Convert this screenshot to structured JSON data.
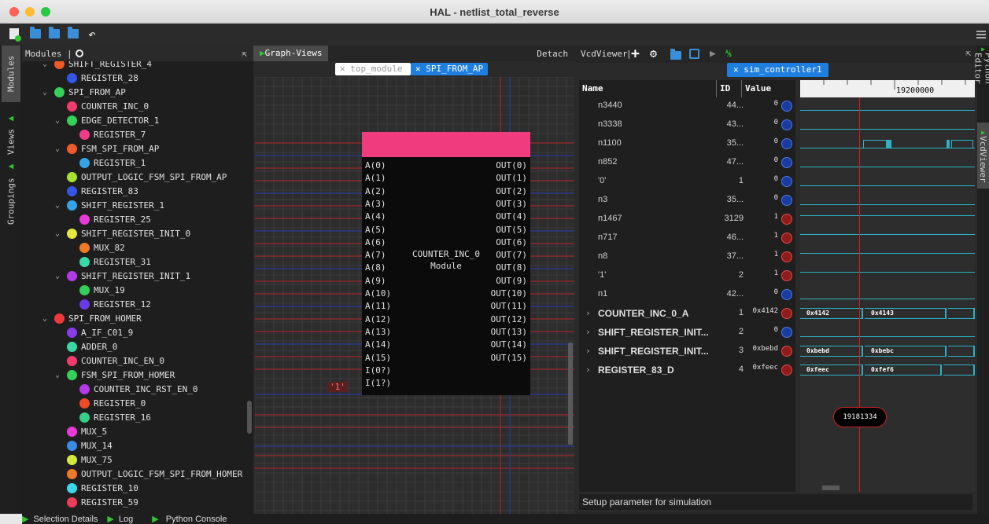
{
  "window": {
    "title": "HAL - netlist_total_reverse"
  },
  "left_tabs": {
    "modules": "Modules",
    "views": "Views",
    "groupings": "Groupings"
  },
  "modules_panel": {
    "title": "Modules |"
  },
  "tree": [
    {
      "label": "SHIFT_REGISTER_4",
      "indent": 1,
      "chevron": true,
      "color": "#f05a28"
    },
    {
      "label": "REGISTER_28",
      "indent": 2,
      "chevron": false,
      "color": "#3554e8"
    },
    {
      "label": "SPI_FROM_AP",
      "indent": 1,
      "chevron": true,
      "color": "#34d058"
    },
    {
      "label": "COUNTER_INC_0",
      "indent": 2,
      "chevron": false,
      "color": "#f23b6b"
    },
    {
      "label": "EDGE_DETECTOR_1",
      "indent": 2,
      "chevron": true,
      "color": "#34d058"
    },
    {
      "label": "REGISTER_7",
      "indent": 3,
      "chevron": false,
      "color": "#f23b8a"
    },
    {
      "label": "FSM_SPI_FROM_AP",
      "indent": 2,
      "chevron": true,
      "color": "#f05a28"
    },
    {
      "label": "REGISTER_1",
      "indent": 3,
      "chevron": false,
      "color": "#36a3e8"
    },
    {
      "label": "OUTPUT_LOGIC_FSM_SPI_FROM_AP",
      "indent": 2,
      "chevron": false,
      "color": "#a6e22e"
    },
    {
      "label": "REGISTER_83",
      "indent": 2,
      "chevron": false,
      "color": "#3554e8"
    },
    {
      "label": "SHIFT_REGISTER_1",
      "indent": 2,
      "chevron": true,
      "color": "#36a3e8"
    },
    {
      "label": "REGISTER_25",
      "indent": 3,
      "chevron": false,
      "color": "#e83ad8"
    },
    {
      "label": "SHIFT_REGISTER_INIT_0",
      "indent": 2,
      "chevron": true,
      "color": "#e8e83a"
    },
    {
      "label": "MUX_82",
      "indent": 3,
      "chevron": false,
      "color": "#f07a28"
    },
    {
      "label": "REGISTER_31",
      "indent": 3,
      "chevron": false,
      "color": "#3ad8a8"
    },
    {
      "label": "SHIFT_REGISTER_INIT_1",
      "indent": 2,
      "chevron": true,
      "color": "#b43ae8"
    },
    {
      "label": "MUX_19",
      "indent": 3,
      "chevron": false,
      "color": "#34d058"
    },
    {
      "label": "REGISTER_12",
      "indent": 3,
      "chevron": false,
      "color": "#6a3ae8"
    },
    {
      "label": "SPI_FROM_HOMER",
      "indent": 1,
      "chevron": true,
      "color": "#f03a3a"
    },
    {
      "label": "A_IF_C01_9",
      "indent": 2,
      "chevron": false,
      "color": "#8a3ae8"
    },
    {
      "label": "ADDER_0",
      "indent": 2,
      "chevron": false,
      "color": "#3ad8a8"
    },
    {
      "label": "COUNTER_INC_EN_0",
      "indent": 2,
      "chevron": false,
      "color": "#f23b6b"
    },
    {
      "label": "FSM_SPI_FROM_HOMER",
      "indent": 2,
      "chevron": true,
      "color": "#34d058"
    },
    {
      "label": "COUNTER_INC_RST_EN_0",
      "indent": 3,
      "chevron": false,
      "color": "#b43ae8"
    },
    {
      "label": "REGISTER_0",
      "indent": 3,
      "chevron": false,
      "color": "#f04a28"
    },
    {
      "label": "REGISTER_16",
      "indent": 3,
      "chevron": false,
      "color": "#34d08a"
    },
    {
      "label": "MUX_5",
      "indent": 2,
      "chevron": false,
      "color": "#e83ad8"
    },
    {
      "label": "MUX_14",
      "indent": 2,
      "chevron": false,
      "color": "#3a8ae8"
    },
    {
      "label": "MUX_75",
      "indent": 2,
      "chevron": false,
      "color": "#d8e83a"
    },
    {
      "label": "OUTPUT_LOGIC_FSM_SPI_FROM_HOMER",
      "indent": 2,
      "chevron": false,
      "color": "#f07a28"
    },
    {
      "label": "REGISTER_10",
      "indent": 2,
      "chevron": false,
      "color": "#3ad8e8"
    },
    {
      "label": "REGISTER_59",
      "indent": 2,
      "chevron": false,
      "color": "#f03a5a"
    }
  ],
  "graph": {
    "panel_tab": "Graph-Views",
    "detach": "Detach",
    "tab_top": "top_module",
    "tab_spi": "SPI_FROM_AP",
    "module_name": "COUNTER_INC_0",
    "module_type": "Module",
    "inputs": [
      "A(0)",
      "A(1)",
      "A(2)",
      "A(3)",
      "A(4)",
      "A(5)",
      "A(6)",
      "A(7)",
      "A(8)",
      "A(9)",
      "A(10)",
      "A(11)",
      "A(12)",
      "A(13)",
      "A(14)",
      "A(15)",
      "I(0?)",
      "I(1?)"
    ],
    "outputs": [
      "OUT(0)",
      "OUT(1)",
      "OUT(2)",
      "OUT(3)",
      "OUT(4)",
      "OUT(5)",
      "OUT(6)",
      "OUT(7)",
      "OUT(8)",
      "OUT(9)",
      "OUT(10)",
      "OUT(11)",
      "OUT(12)",
      "OUT(13)",
      "OUT(14)",
      "OUT(15)"
    ],
    "const_label": "'1'"
  },
  "vcd": {
    "title": "VcdViewer",
    "sim_tab": "sim_controller1",
    "col_name": "Name",
    "col_id": "ID",
    "col_value": "Value",
    "ruler_time": "19200000",
    "tooltip": "19181334",
    "status": "Setup parameter for simulation",
    "signals": [
      {
        "name": "n3440",
        "id": "44...",
        "value": "0",
        "circle": "blue",
        "bold": false
      },
      {
        "name": "n3338",
        "id": "43...",
        "value": "0",
        "circle": "blue",
        "bold": false
      },
      {
        "name": "n1100",
        "id": "35...",
        "value": "0",
        "circle": "blue",
        "bold": false
      },
      {
        "name": "n852",
        "id": "47...",
        "value": "0",
        "circle": "blue",
        "bold": false
      },
      {
        "name": "'0'",
        "id": "1",
        "value": "0",
        "circle": "blue",
        "bold": false
      },
      {
        "name": "n3",
        "id": "35...",
        "value": "0",
        "circle": "blue",
        "bold": false
      },
      {
        "name": "n1467",
        "id": "3129",
        "value": "1",
        "circle": "red",
        "bold": false
      },
      {
        "name": "n717",
        "id": "46...",
        "value": "1",
        "circle": "red",
        "bold": false
      },
      {
        "name": "n8",
        "id": "37...",
        "value": "1",
        "circle": "red",
        "bold": false
      },
      {
        "name": "'1'",
        "id": "2",
        "value": "1",
        "circle": "red",
        "bold": false
      },
      {
        "name": "n1",
        "id": "42...",
        "value": "0",
        "circle": "blue",
        "bold": false
      },
      {
        "name": "COUNTER_INC_0_A",
        "id": "1",
        "value": "0x4142",
        "circle": "red",
        "bold": true
      },
      {
        "name": "SHIFT_REGISTER_INIT...",
        "id": "2",
        "value": "0",
        "circle": "blue",
        "bold": true
      },
      {
        "name": "SHIFT_REGISTER_INIT...",
        "id": "3",
        "value": "0xbebd",
        "circle": "red",
        "bold": true
      },
      {
        "name": "REGISTER_83_D",
        "id": "4",
        "value": "0xfeec",
        "circle": "red",
        "bold": true
      }
    ],
    "bus_labels": {
      "counter_a": "0x4142",
      "counter_b": "0x4143",
      "shift_a": "0xbebd",
      "shift_b": "0xbebc",
      "reg_a": "0xfeec",
      "reg_b": "0xfef6"
    }
  },
  "right_tabs": {
    "python_editor": "Python Editor",
    "vcdviewer": "VcdViewer"
  },
  "bottom_bar": {
    "selection_details": "Selection Details",
    "log": "Log",
    "python_console": "Python Console"
  }
}
